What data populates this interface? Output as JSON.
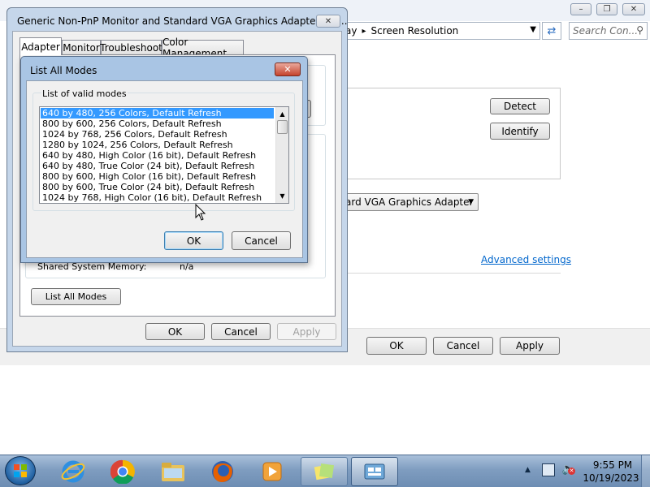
{
  "bg_window": {
    "breadcrumb_partial": "ay",
    "breadcrumb_sep": "▸",
    "breadcrumb_current": "Screen Resolution",
    "search_placeholder": "Search Con...",
    "detect_label": "Detect",
    "identify_label": "Identify",
    "display_dropdown_value": "ard VGA Graphics Adapter",
    "advanced_link": "Advanced settings",
    "ok_label": "OK",
    "cancel_label": "Cancel",
    "apply_label": "Apply"
  },
  "props_dialog": {
    "title": "Generic Non-PnP Monitor and Standard VGA Graphics Adapter Pro...",
    "tabs": [
      "Adapter",
      "Monitor",
      "Troubleshoot",
      "Color Management"
    ],
    "shared_memory_label": "Shared System Memory:",
    "shared_memory_value": "n/a",
    "list_all_modes_label": "List All Modes",
    "ok_label": "OK",
    "cancel_label": "Cancel",
    "apply_label": "Apply"
  },
  "modes_dialog": {
    "title": "List All Modes",
    "group_label": "List of valid modes",
    "modes": [
      "640 by 480, 256 Colors, Default Refresh",
      "800 by 600, 256 Colors, Default Refresh",
      "1024 by 768, 256 Colors, Default Refresh",
      "1280 by 1024, 256 Colors, Default Refresh",
      "640 by 480, High Color (16 bit), Default Refresh",
      "640 by 480, True Color (24 bit), Default Refresh",
      "800 by 600, High Color (16 bit), Default Refresh",
      "800 by 600, True Color (24 bit), Default Refresh",
      "1024 by 768, High Color (16 bit), Default Refresh"
    ],
    "selected_index": 0,
    "ok_label": "OK",
    "cancel_label": "Cancel"
  },
  "taskbar": {
    "time": "9:55 PM",
    "date": "10/19/2023"
  }
}
